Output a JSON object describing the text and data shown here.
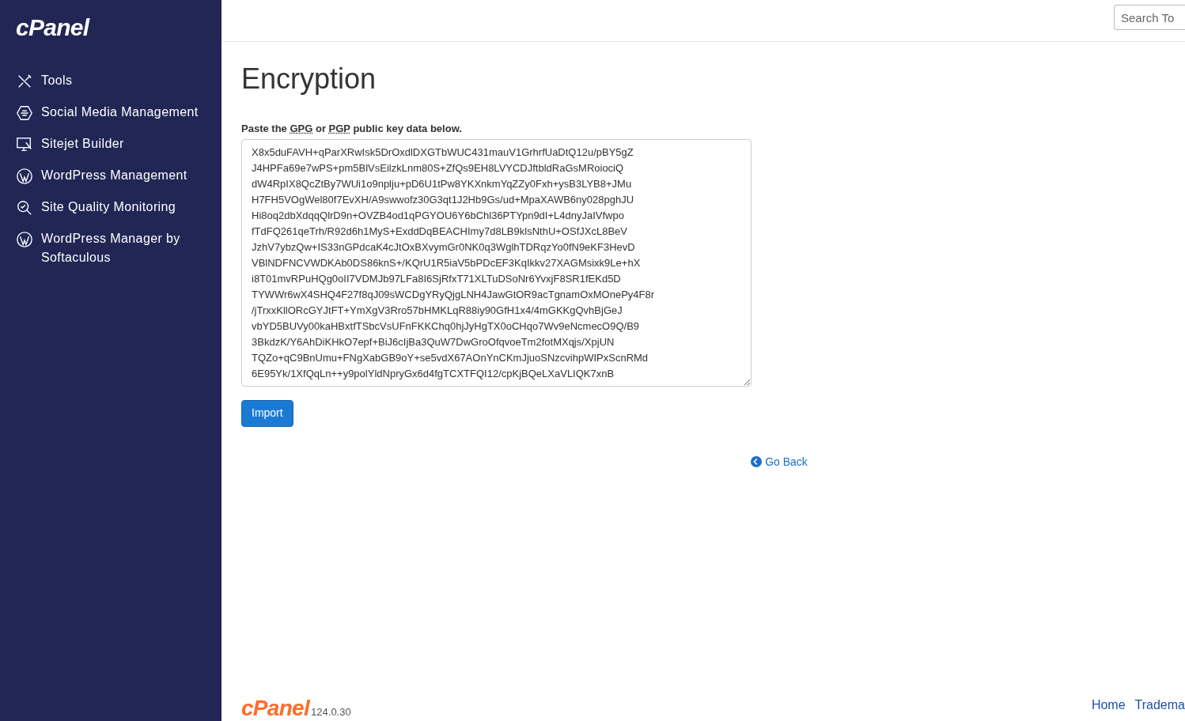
{
  "sidebar": {
    "logo": "cPanel",
    "items": [
      {
        "label": "Tools"
      },
      {
        "label": "Social Media Management"
      },
      {
        "label": "Sitejet Builder"
      },
      {
        "label": "WordPress Management"
      },
      {
        "label": "Site Quality Monitoring"
      },
      {
        "label": "WordPress Manager by Softaculous"
      }
    ]
  },
  "header": {
    "search": {
      "placeholder": "Search To"
    }
  },
  "page": {
    "title": "Encryption",
    "instruction": [
      {
        "kind": "text",
        "text": "Paste the "
      },
      {
        "kind": "abbr",
        "text": "GPG"
      },
      {
        "kind": "text",
        "text": " or "
      },
      {
        "kind": "abbr",
        "text": "PGP"
      },
      {
        "kind": "text",
        "text": " public key data below."
      }
    ],
    "key_lines": [
      "X8x5duFAVH+qParXRwIsk5DrOxdlDXGTbWUC431mauV1GrhrfUaDtQ12u/pBY5gZ",
      "J4HPFa69e7wPS+pm5BlVsEilzkLnm80S+ZfQs9EH8LVYCDJftbldRaGsMRoiociQ",
      "dW4RpIX8QcZtBy7WUi1o9nplju+pD6U1tPw8YKXnkmYqZZy0Fxh+ysB3LYB8+JMu",
      "H7FH5VOgWel80f7EvXH/A9swwofz30G3qt1J2Hb9Gs/ud+MpaXAWB6ny028pghJU",
      "Hi8oq2dbXdqqQlrD9n+OVZB4od1qPGYOU6Y6bChl36PTYpn9dI+L4dnyJaIVfwpo",
      "fTdFQ261qeTrh/R92d6h1MyS+ExddDqBEACHImy7d8LB9klsNthU+OSfJXcL8BeV",
      "JzhV7ybzQw+IS33nGPdcaK4cJtOxBXvymGr0NK0q3WglhTDRqzYo0fN9eKF3HevD",
      "VBlNDFNCVWDKAb0DS86knS+/KQrU1R5iaV5bPDcEF3KqIkkv27XAGMsixk9Le+hX",
      "i8T01mvRPuHQg0oII7VDMJb97LFa8I6SjRfxT71XLTuDSoNr6YvxjF8SR1fEKd5D",
      "TYWWr6wX4SHQ4F27f8qJ09sWCDgYRyQjgLNH4JawGtOR9acTgnamOxMOnePy4F8r",
      "/jTrxxKllORcGYJtFT+YmXgV3Rro57bHMKLqR88iy90GfH1x4/4mGKKgQvhBjGeJ",
      "vbYD5BUVy00kaHBxtfTSbcVsUFnFKKChq0hjJyHgTX0oCHqo7Wv9eNcmecO9Q/B9",
      "3BkdzK/Y6AhDiKHkO7epf+BiJ6cIjBa3QuW7DwGroOfqvoeTm2fotMXqjs/XpjUN",
      "TQZo+qC9BnUmu+FNgXabGB9oY+se5vdX67AOnYnCKmJjuoSNzcvihpWIPxScnRMd",
      "6E95Yk/1XfQqLn++y9polYldNpryGx6d4fgTCXTFQI12/cpKjBQeLXaVLIQK7xnB"
    ],
    "import_button": "Import",
    "back_link": "Go Back"
  },
  "footer": {
    "logo": "cPanel",
    "version": "124.0.30",
    "links": [
      "Home",
      "Tradema"
    ]
  }
}
